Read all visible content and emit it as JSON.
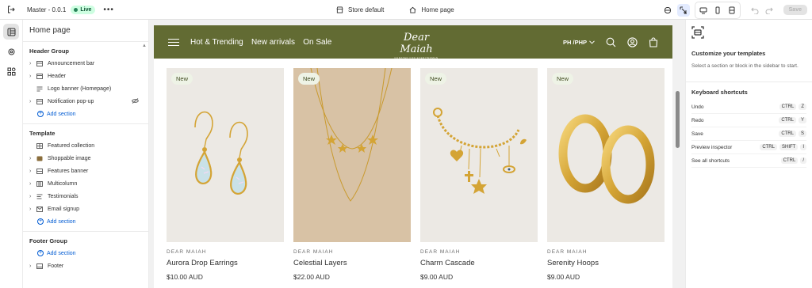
{
  "topbar": {
    "theme_name": "Master - 0.0.1",
    "live_label": "Live",
    "more_label": "•••",
    "store_label": "Store default",
    "page_label": "Home page",
    "save_label": "Save"
  },
  "sidebar": {
    "title": "Home page",
    "header_group": {
      "title": "Header Group",
      "items": [
        "Announcement bar",
        "Header",
        "Logo banner (Homepage)",
        "Notification pop-up"
      ],
      "add_label": "Add section"
    },
    "template": {
      "title": "Template",
      "items": [
        "Featured collection",
        "Shoppable image",
        "Features banner",
        "Multicolumn",
        "Testimonials",
        "Email signup"
      ],
      "add_label": "Add section"
    },
    "footer_group": {
      "title": "Footer Group",
      "add_label": "Add section",
      "items": [
        "Footer"
      ]
    }
  },
  "store": {
    "nav": [
      "Hot & Trending",
      "New arrivals",
      "On Sale"
    ],
    "logo": "Dear Maiah",
    "logo_sub": "CURATED FOR EVERYWOMAN",
    "currency": "PH /PHP",
    "products": [
      {
        "badge": "New",
        "brand": "DEAR MAIAH",
        "name": "Aurora Drop Earrings",
        "price": "$10.00 AUD"
      },
      {
        "badge": "New",
        "brand": "DEAR MAIAH",
        "name": "Celestial Layers",
        "price": "$22.00 AUD"
      },
      {
        "badge": "New",
        "brand": "DEAR MAIAH",
        "name": "Charm Cascade",
        "price": "$9.00 AUD"
      },
      {
        "badge": "New",
        "brand": "DEAR MAIAH",
        "name": "Serenity Hoops",
        "price": "$9.00 AUD"
      }
    ]
  },
  "right_panel": {
    "title": "Customize your templates",
    "description": "Select a section or block in the sidebar to start.",
    "shortcuts_title": "Keyboard shortcuts",
    "shortcuts": [
      {
        "label": "Undo",
        "keys": [
          "CTRL",
          "Z"
        ]
      },
      {
        "label": "Redo",
        "keys": [
          "CTRL",
          "Y"
        ]
      },
      {
        "label": "Save",
        "keys": [
          "CTRL",
          "S"
        ]
      },
      {
        "label": "Preview inspector",
        "keys": [
          "CTRL",
          "SHIFT",
          "I"
        ]
      },
      {
        "label": "See all shortcuts",
        "keys": [
          "CTRL",
          "/"
        ]
      }
    ]
  },
  "colors": {
    "header_bg": "#626b33",
    "live_badge": "#cdfee1",
    "link": "#005bd3",
    "gold": "#d4a435"
  }
}
